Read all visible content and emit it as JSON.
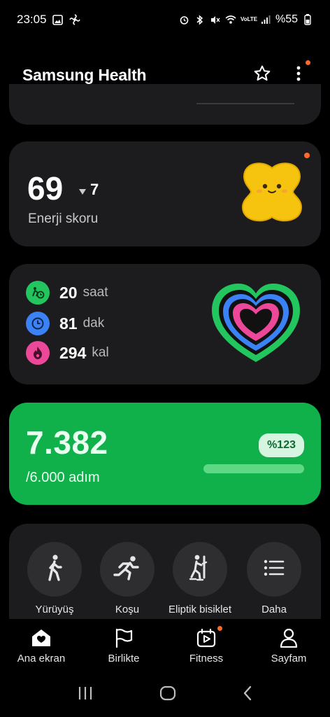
{
  "status_bar": {
    "time": "23:05",
    "battery_text": "%55",
    "network_label": "VoLTE"
  },
  "header": {
    "title": "Samsung Health",
    "icons": [
      "star-icon",
      "more-vertical-icon"
    ]
  },
  "energy": {
    "score": "69",
    "change": "7",
    "label": "Enerji skoru"
  },
  "activity": {
    "rows": [
      {
        "value": "20",
        "unit": "saat",
        "icon": "active-hours-icon",
        "color": "#22c55e"
      },
      {
        "value": "81",
        "unit": "dak",
        "icon": "clock-icon",
        "color": "#3b82f6"
      },
      {
        "value": "294",
        "unit": "kal",
        "icon": "flame-icon",
        "color": "#ec4899"
      }
    ]
  },
  "steps": {
    "value": "7.382",
    "goal": "/6.000 adım",
    "percent_label": "%123",
    "progress": 1.0
  },
  "workouts": [
    {
      "label": "Yürüyüş",
      "icon": "walking-icon"
    },
    {
      "label": "Koşu",
      "icon": "running-icon"
    },
    {
      "label": "Eliptik bisiklet",
      "icon": "elliptical-icon"
    },
    {
      "label": "Daha",
      "icon": "list-icon"
    }
  ],
  "bottom_nav": [
    {
      "label": "Ana ekran",
      "icon": "home-heart-icon"
    },
    {
      "label": "Birlikte",
      "icon": "flag-icon"
    },
    {
      "label": "Fitness",
      "icon": "fitness-play-icon"
    },
    {
      "label": "Sayfam",
      "icon": "person-icon"
    }
  ],
  "colors": {
    "accent_green": "#10b04a",
    "notification_dot": "#ff6a2c",
    "card_bg": "#1c1c1e"
  }
}
